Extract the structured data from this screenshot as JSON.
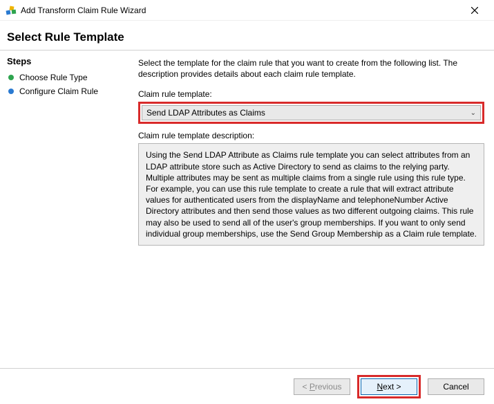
{
  "window": {
    "title": "Add Transform Claim Rule Wizard"
  },
  "heading": "Select Rule Template",
  "sidebar": {
    "title": "Steps",
    "items": [
      {
        "label": "Choose Rule Type"
      },
      {
        "label": "Configure Claim Rule"
      }
    ]
  },
  "main": {
    "intro": "Select the template for the claim rule that you want to create from the following list. The description provides details about each claim rule template.",
    "template_label": "Claim rule template:",
    "template_value": "Send LDAP Attributes as Claims",
    "desc_label": "Claim rule template description:",
    "desc_text": "Using the Send LDAP Attribute as Claims rule template you can select attributes from an LDAP attribute store such as Active Directory to send as claims to the relying party. Multiple attributes may be sent as multiple claims from a single rule using this rule type. For example, you can use this rule template to create a rule that will extract attribute values for authenticated users from the displayName and telephoneNumber Active Directory attributes and then send those values as two different outgoing claims. This rule may also be used to send all of the user's group memberships. If you want to only send individual group memberships, use the Send Group Membership as a Claim rule template."
  },
  "footer": {
    "previous": "< Previous",
    "next_prefix": "N",
    "next_rest": "ext >",
    "cancel": "Cancel"
  }
}
